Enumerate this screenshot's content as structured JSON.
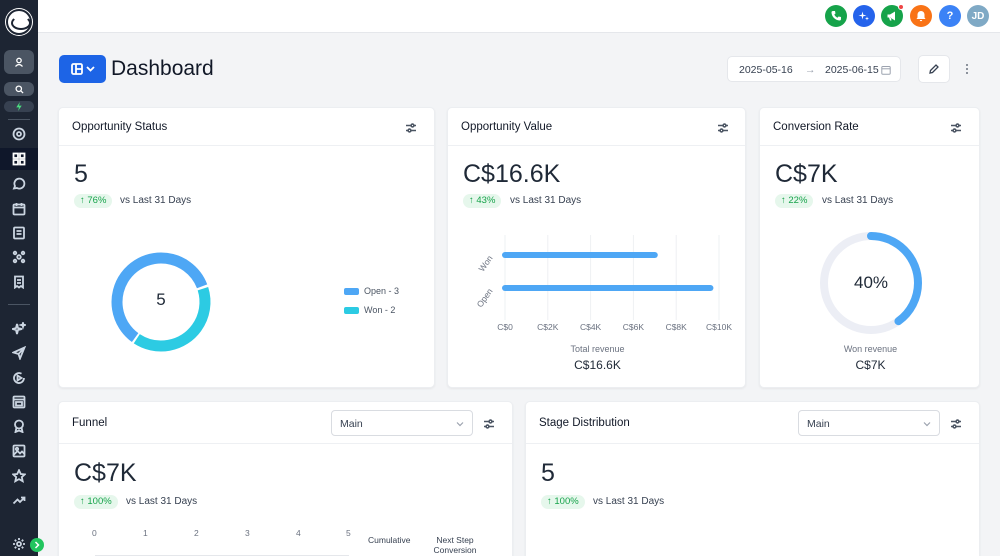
{
  "header": {
    "title": "Dashboard",
    "date_start": "2025-05-16",
    "date_end": "2025-06-15",
    "arrow": "→"
  },
  "topbar": {
    "avatar_initials": "JD",
    "help_label": "?",
    "colors": {
      "phone": "#16a34a",
      "ai": "#2563eb",
      "announce": "#16a34a",
      "bell": "#f97316",
      "help": "#3b82f6",
      "avatar": "#7fa9c5"
    }
  },
  "cards": {
    "opportunity_status": {
      "title": "Opportunity Status",
      "value": "5",
      "change": "↑ 76%",
      "vs": "vs Last 31 Days",
      "donut_center": "5",
      "legend": [
        {
          "label": "Open - 3",
          "color": "#4ea7f5"
        },
        {
          "label": "Won - 2",
          "color": "#2ccbe3"
        }
      ]
    },
    "opportunity_value": {
      "title": "Opportunity Value",
      "value": "C$16.6K",
      "change": "↑ 43%",
      "vs": "vs Last 31 Days",
      "caption": "Total revenue",
      "caption_value": "C$16.6K"
    },
    "conversion_rate": {
      "title": "Conversion Rate",
      "value": "C$7K",
      "change": "↑ 22%",
      "vs": "vs Last 31 Days",
      "gauge_label": "40%",
      "gauge_fraction": 0.4,
      "caption": "Won revenue",
      "caption_value": "C$7K"
    },
    "funnel": {
      "title": "Funnel",
      "select_value": "Main",
      "value": "C$7K",
      "change": "↑ 100%",
      "vs": "vs Last 31 Days",
      "axis_ticks": [
        "0",
        "1",
        "2",
        "3",
        "4",
        "5"
      ],
      "col_cumulative": "Cumulative",
      "col_next_step_1": "Next Step",
      "col_next_step_2": "Conversion"
    },
    "stage_distribution": {
      "title": "Stage Distribution",
      "select_value": "Main",
      "value": "5",
      "change": "↑ 100%",
      "vs": "vs Last 31 Days"
    }
  },
  "chart_data": [
    {
      "type": "pie",
      "categories": [
        "Open",
        "Won"
      ],
      "values": [
        3,
        2
      ],
      "colors": [
        "#4ea7f5",
        "#2ccbe3"
      ],
      "legend": "right"
    },
    {
      "type": "bar",
      "orientation": "horizontal",
      "categories": [
        "Won",
        "Open"
      ],
      "values": [
        7000,
        9600
      ],
      "xlim": [
        0,
        10000
      ],
      "xticks": [
        "C$0",
        "C$2K",
        "C$4K",
        "C$6K",
        "C$8K",
        "C$10K"
      ],
      "color": "#4ea7f5",
      "grid": true
    }
  ]
}
